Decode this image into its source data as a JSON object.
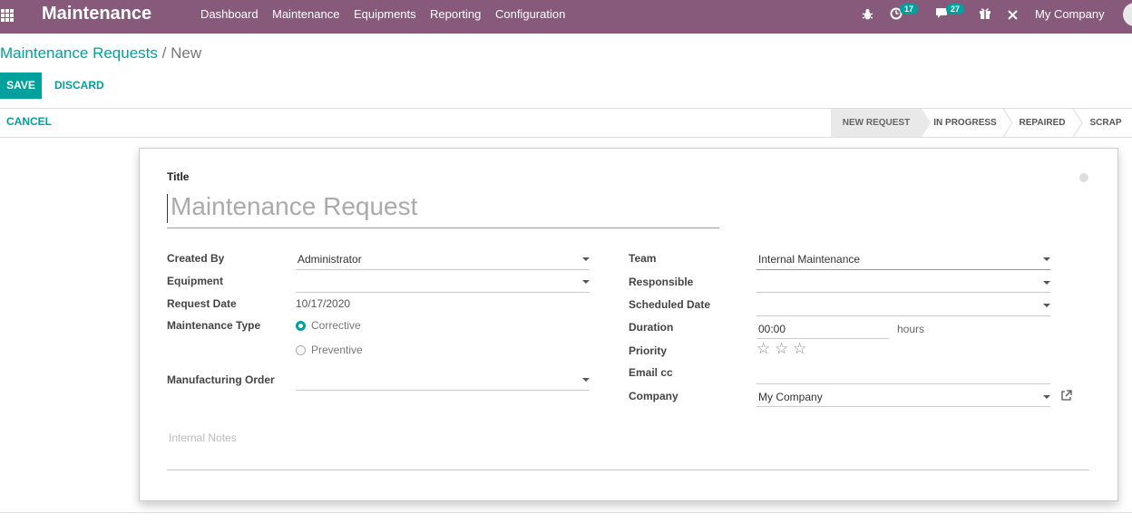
{
  "navbar": {
    "brand": "Maintenance",
    "menu": [
      "Dashboard",
      "Maintenance",
      "Equipments",
      "Reporting",
      "Configuration"
    ],
    "activity_badge": "17",
    "messages_badge": "27",
    "company": "My Company"
  },
  "breadcrumb": {
    "parent": "Maintenance Requests",
    "separator": "/",
    "current": "New"
  },
  "buttons": {
    "save": "SAVE",
    "discard": "DISCARD",
    "cancel": "CANCEL"
  },
  "stages": [
    "NEW REQUEST",
    "IN PROGRESS",
    "REPAIRED",
    "SCRAP"
  ],
  "active_stage": "NEW REQUEST",
  "form": {
    "title_label": "Title",
    "title_placeholder": "Maintenance Request",
    "left": {
      "created_by_label": "Created By",
      "created_by_value": "Administrator",
      "equipment_label": "Equipment",
      "equipment_value": "",
      "request_date_label": "Request Date",
      "request_date_value": "10/17/2020",
      "maintenance_type_label": "Maintenance Type",
      "maintenance_type_options": [
        "Corrective",
        "Preventive"
      ],
      "maintenance_type_selected": "Corrective",
      "manufacturing_order_label": "Manufacturing Order",
      "manufacturing_order_value": ""
    },
    "right": {
      "team_label": "Team",
      "team_value": "Internal Maintenance",
      "responsible_label": "Responsible",
      "responsible_value": "",
      "scheduled_date_label": "Scheduled Date",
      "scheduled_date_value": "",
      "duration_label": "Duration",
      "duration_value": "00:00",
      "duration_unit": "hours",
      "priority_label": "Priority",
      "priority_stars": 0,
      "email_cc_label": "Email cc",
      "email_cc_value": "",
      "company_label": "Company",
      "company_value": "My Company"
    },
    "notes_placeholder": "Internal Notes"
  },
  "colors": {
    "navbar": "#875a7b",
    "accent": "#00a09d"
  }
}
